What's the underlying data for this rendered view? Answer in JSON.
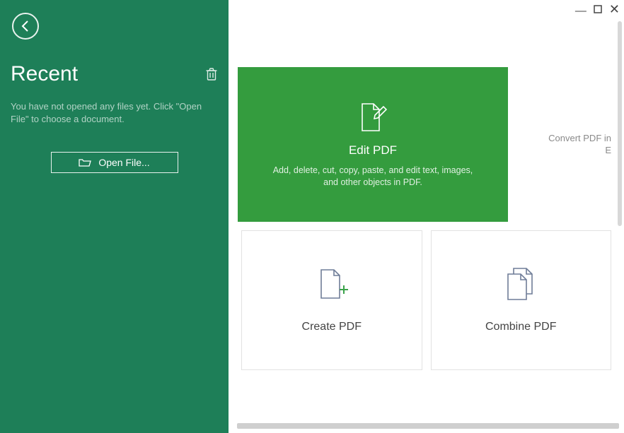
{
  "sidebar": {
    "title": "Recent",
    "empty_message": "You have not opened any files yet. Click \"Open File\" to choose a document.",
    "open_file_label": "Open File..."
  },
  "main": {
    "edit_card": {
      "title": "Edit PDF",
      "desc": "Add, delete, cut, copy, paste, and edit text, images, and other objects in PDF."
    },
    "convert_peek": "Convert PDF in\nE",
    "create_card": {
      "title": "Create PDF"
    },
    "combine_card": {
      "title": "Combine PDF"
    }
  }
}
